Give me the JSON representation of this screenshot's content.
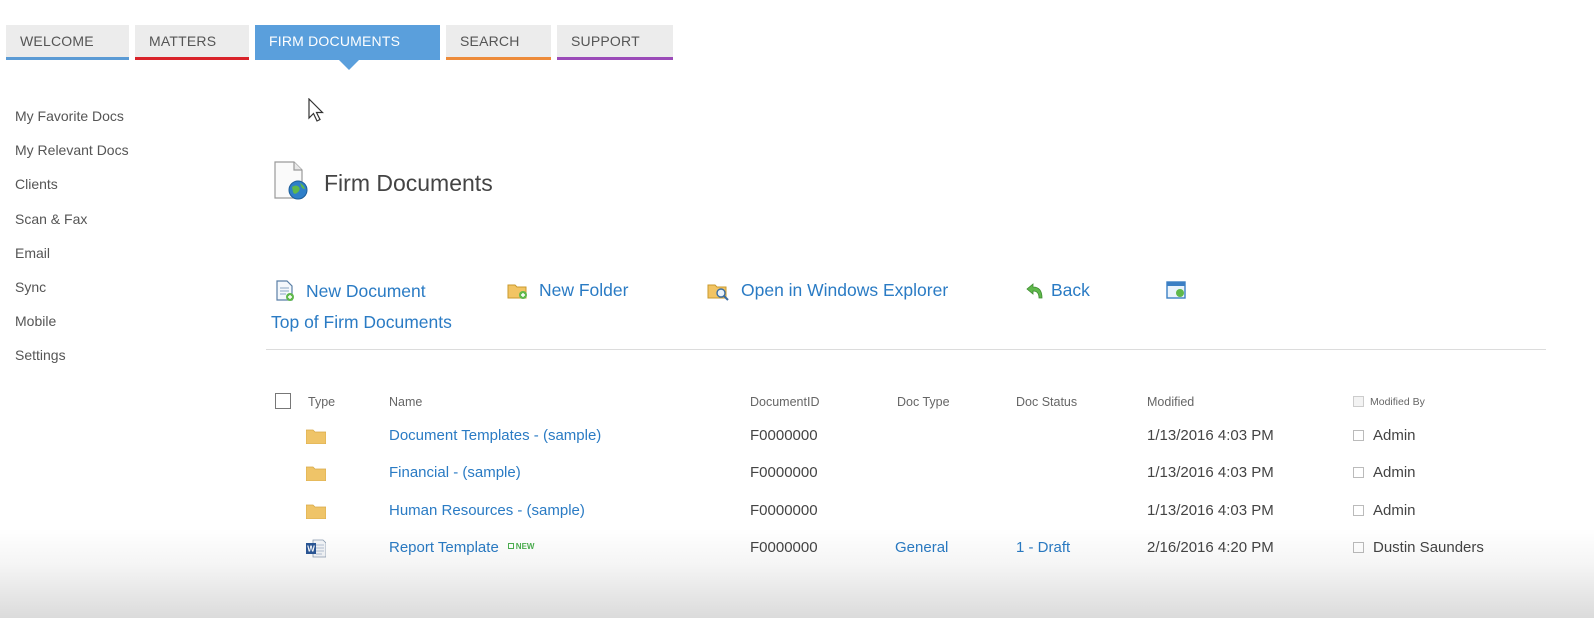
{
  "tabs": [
    {
      "label": "WELCOME",
      "color": "#5b9bd5"
    },
    {
      "label": "MATTERS",
      "color": "#d9232a"
    },
    {
      "label": "FIRM DOCUMENTS",
      "color": "#5a9fdc",
      "active": true
    },
    {
      "label": "SEARCH",
      "color": "#ed8b3a"
    },
    {
      "label": "SUPPORT",
      "color": "#9b4bb8"
    }
  ],
  "sidebar": {
    "items": [
      {
        "label": "My Favorite Docs"
      },
      {
        "label": "My Relevant Docs"
      },
      {
        "label": "Clients"
      },
      {
        "label": "Scan & Fax"
      },
      {
        "label": "Email"
      },
      {
        "label": "Sync"
      },
      {
        "label": "Mobile"
      },
      {
        "label": "Settings"
      }
    ]
  },
  "page": {
    "title": "Firm Documents",
    "icon": "document-globe-icon"
  },
  "toolbar": {
    "new_document": "New Document",
    "new_folder": "New Folder",
    "open_explorer": "Open in Windows Explorer",
    "back": "Back",
    "breadcrumb": "Top of Firm Documents"
  },
  "table": {
    "headers": {
      "type": "Type",
      "name": "Name",
      "document_id": "DocumentID",
      "doc_type": "Doc Type",
      "doc_status": "Doc Status",
      "modified": "Modified",
      "modified_by": "Modified By"
    },
    "rows": [
      {
        "icon": "folder-icon",
        "name": "Document Templates - (sample)",
        "document_id": "F0000000",
        "doc_type": "",
        "doc_status": "",
        "modified": "1/13/2016 4:03 PM",
        "modified_by": "Admin"
      },
      {
        "icon": "folder-icon",
        "name": "Financial - (sample)",
        "document_id": "F0000000",
        "doc_type": "",
        "doc_status": "",
        "modified": "1/13/2016 4:03 PM",
        "modified_by": "Admin"
      },
      {
        "icon": "folder-icon",
        "name": "Human Resources - (sample)",
        "document_id": "F0000000",
        "doc_type": "",
        "doc_status": "",
        "modified": "1/13/2016 4:03 PM",
        "modified_by": "Admin"
      },
      {
        "icon": "word-document-icon",
        "name": "Report Template",
        "badge": "NEW",
        "document_id": "F0000000",
        "doc_type": "General",
        "doc_status": "1 - Draft",
        "modified": "2/16/2016 4:20 PM",
        "modified_by": "Dustin Saunders"
      }
    ]
  },
  "colors": {
    "accent": "#5a9fdc",
    "link": "#2a7bc4"
  }
}
